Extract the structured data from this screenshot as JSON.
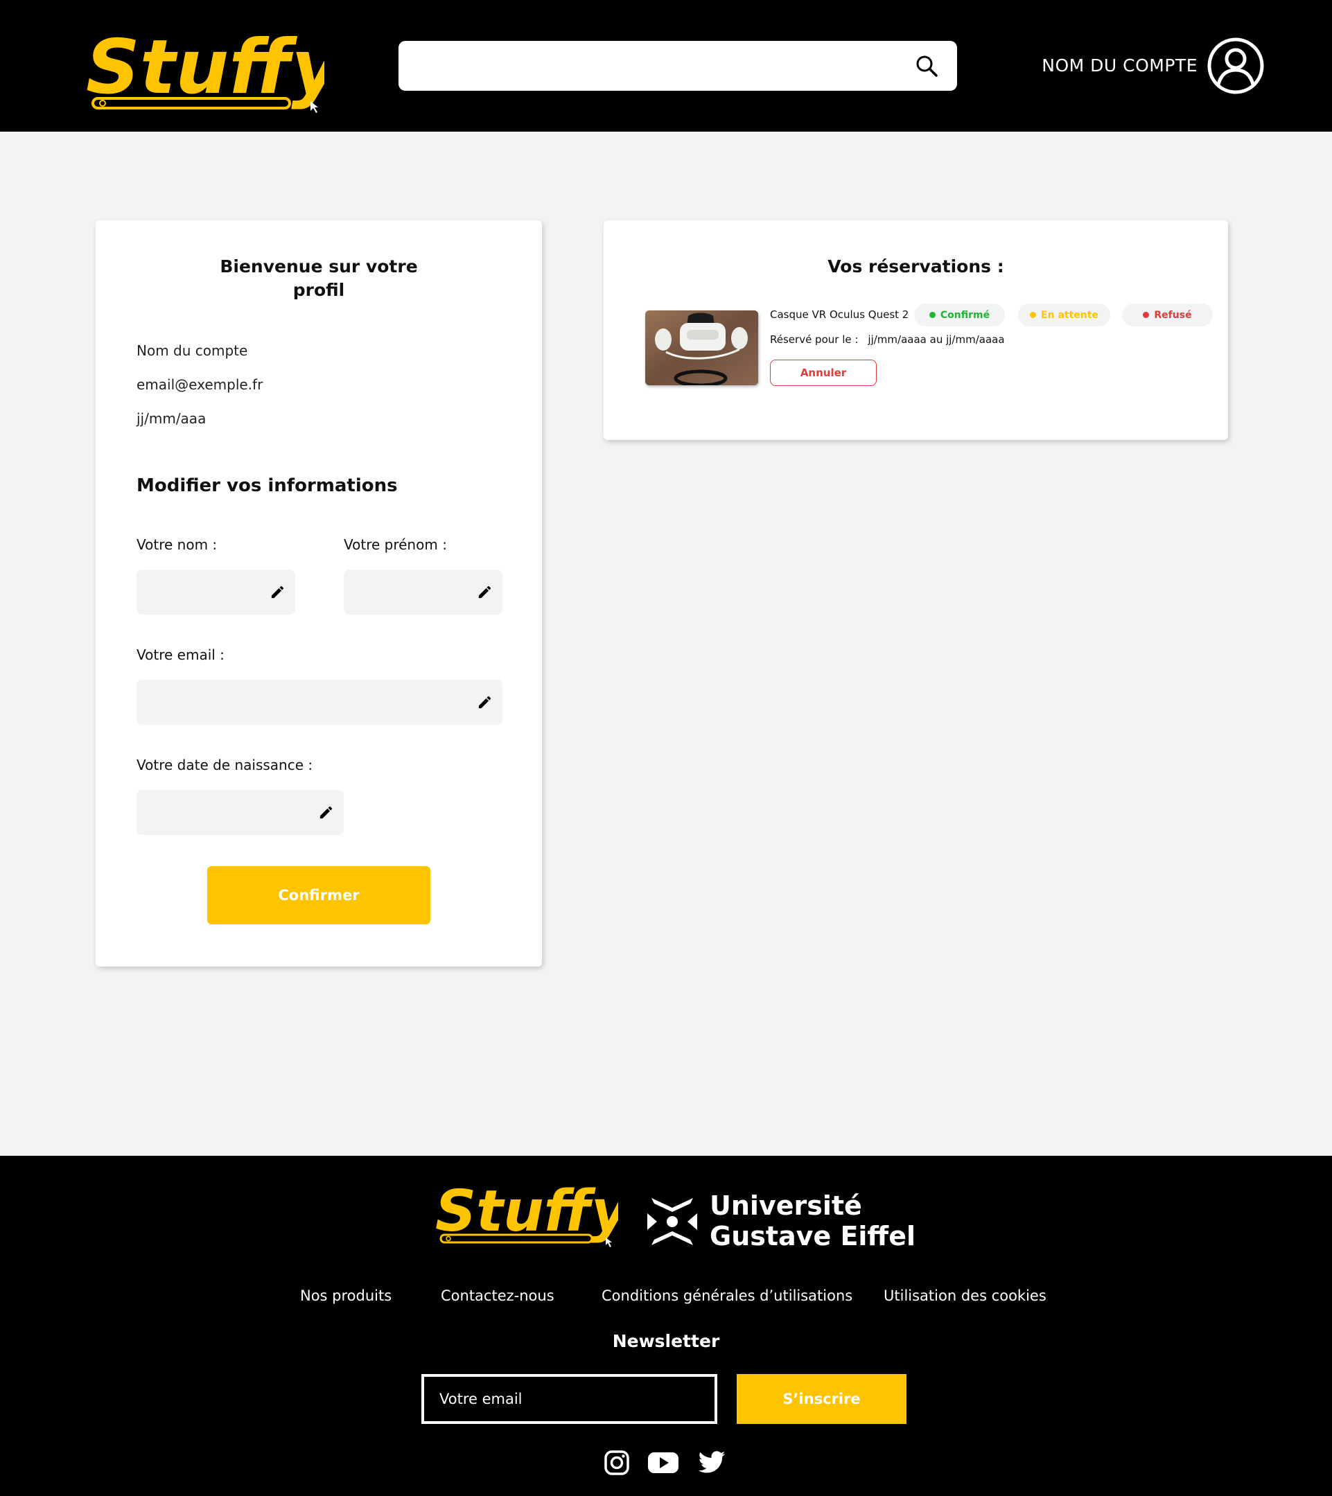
{
  "brand": {
    "name": "Stuffy",
    "accent": "#ffc400",
    "partner": {
      "line1": "Université",
      "line2": "Gustave Eiffel"
    }
  },
  "header": {
    "search": {
      "value": "",
      "placeholder": "",
      "icon": "search-icon"
    },
    "account_name": "NOM DU COMPTE",
    "avatar_icon": "user-circle-icon"
  },
  "profile": {
    "title_line1": "Bienvenue sur votre",
    "title_line2": "profil",
    "account_name": "Nom du compte",
    "email": "email@exemple.fr",
    "birthdate": "jj/mm/aaa",
    "edit_section_title": "Modifier vos informations",
    "fields": {
      "last_name_label": "Votre nom :",
      "first_name_label": "Votre prénom :",
      "email_label": "Votre email :",
      "birthdate_label": "Votre date de naissance :"
    },
    "edit_icon": "pencil-icon",
    "confirm_label": "Confirmer"
  },
  "reservations": {
    "title": "Vos réservations :",
    "items": [
      {
        "product": "Casque VR Oculus Quest 2",
        "reserved_for_label": "Réservé pour le :",
        "dates": "jj/mm/aaaa au jj/mm/aaaa",
        "cancel_label": "Annuler"
      }
    ],
    "statuses": [
      {
        "label": "Confirmé",
        "color": "#22b534"
      },
      {
        "label": "En attente",
        "color": "#ffc400"
      },
      {
        "label": "Refusé",
        "color": "#e03a3a"
      }
    ]
  },
  "footer": {
    "links": [
      "Nos produits",
      "Contactez-nous",
      "Conditions générales d’utilisations",
      "Utilisation des cookies"
    ],
    "newsletter_title": "Newsletter",
    "newsletter_placeholder": "Votre email",
    "subscribe_label": "S’inscrire",
    "social_icons": [
      "instagram-icon",
      "youtube-icon",
      "twitter-icon"
    ]
  }
}
